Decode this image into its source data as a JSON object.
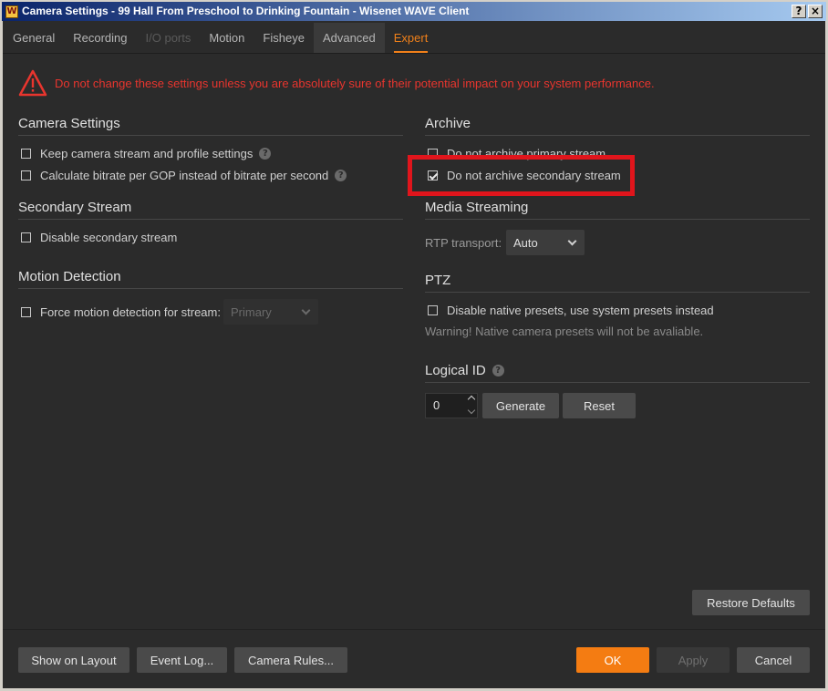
{
  "window": {
    "title": "Camera Settings - 99 Hall From Preschool to Drinking Fountain - Wisenet WAVE Client",
    "app_icon": "W"
  },
  "tabs": [
    {
      "label": "General",
      "state": "normal"
    },
    {
      "label": "Recording",
      "state": "normal"
    },
    {
      "label": "I/O ports",
      "state": "disabled"
    },
    {
      "label": "Motion",
      "state": "normal"
    },
    {
      "label": "Fisheye",
      "state": "normal"
    },
    {
      "label": "Advanced",
      "state": "hover"
    },
    {
      "label": "Expert",
      "state": "active"
    }
  ],
  "warning": {
    "text": "Do not change these settings unless you are absolutely sure of their potential impact on your system performance."
  },
  "camera_settings": {
    "title": "Camera Settings",
    "keep_stream": "Keep camera stream and profile settings",
    "bitrate_gop": "Calculate bitrate per GOP instead of bitrate per second"
  },
  "secondary_stream": {
    "title": "Secondary Stream",
    "disable": "Disable secondary stream"
  },
  "motion_detection": {
    "title": "Motion Detection",
    "force": "Force motion detection for stream:",
    "stream_value": "Primary"
  },
  "archive": {
    "title": "Archive",
    "primary": "Do not archive primary stream",
    "secondary": "Do not archive secondary stream",
    "secondary_checked": true
  },
  "media_streaming": {
    "title": "Media Streaming",
    "rtp_label": "RTP transport:",
    "rtp_value": "Auto"
  },
  "ptz": {
    "title": "PTZ",
    "disable_presets": "Disable native presets, use system presets instead",
    "warning": "Warning! Native camera presets will not be avaliable."
  },
  "logical_id": {
    "title": "Logical ID",
    "value": "0",
    "generate": "Generate",
    "reset": "Reset"
  },
  "restore_defaults": "Restore Defaults",
  "footer": {
    "show_on_layout": "Show on Layout",
    "event_log": "Event Log...",
    "camera_rules": "Camera Rules...",
    "ok": "OK",
    "apply": "Apply",
    "cancel": "Cancel"
  },
  "colors": {
    "accent": "#f47c12",
    "warning": "#e8352e",
    "highlight": "#e0151c",
    "background": "#2b2b2b"
  }
}
